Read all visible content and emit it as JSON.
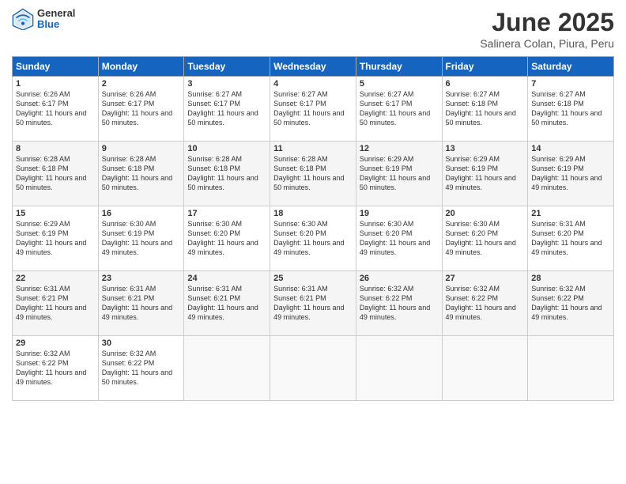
{
  "header": {
    "logo_general": "General",
    "logo_blue": "Blue",
    "title": "June 2025",
    "subtitle": "Salinera Colan, Piura, Peru"
  },
  "calendar": {
    "days_of_week": [
      "Sunday",
      "Monday",
      "Tuesday",
      "Wednesday",
      "Thursday",
      "Friday",
      "Saturday"
    ],
    "weeks": [
      [
        {
          "day": "1",
          "sunrise": "Sunrise: 6:26 AM",
          "sunset": "Sunset: 6:17 PM",
          "daylight": "Daylight: 11 hours and 50 minutes."
        },
        {
          "day": "2",
          "sunrise": "Sunrise: 6:26 AM",
          "sunset": "Sunset: 6:17 PM",
          "daylight": "Daylight: 11 hours and 50 minutes."
        },
        {
          "day": "3",
          "sunrise": "Sunrise: 6:27 AM",
          "sunset": "Sunset: 6:17 PM",
          "daylight": "Daylight: 11 hours and 50 minutes."
        },
        {
          "day": "4",
          "sunrise": "Sunrise: 6:27 AM",
          "sunset": "Sunset: 6:17 PM",
          "daylight": "Daylight: 11 hours and 50 minutes."
        },
        {
          "day": "5",
          "sunrise": "Sunrise: 6:27 AM",
          "sunset": "Sunset: 6:17 PM",
          "daylight": "Daylight: 11 hours and 50 minutes."
        },
        {
          "day": "6",
          "sunrise": "Sunrise: 6:27 AM",
          "sunset": "Sunset: 6:18 PM",
          "daylight": "Daylight: 11 hours and 50 minutes."
        },
        {
          "day": "7",
          "sunrise": "Sunrise: 6:27 AM",
          "sunset": "Sunset: 6:18 PM",
          "daylight": "Daylight: 11 hours and 50 minutes."
        }
      ],
      [
        {
          "day": "8",
          "sunrise": "Sunrise: 6:28 AM",
          "sunset": "Sunset: 6:18 PM",
          "daylight": "Daylight: 11 hours and 50 minutes."
        },
        {
          "day": "9",
          "sunrise": "Sunrise: 6:28 AM",
          "sunset": "Sunset: 6:18 PM",
          "daylight": "Daylight: 11 hours and 50 minutes."
        },
        {
          "day": "10",
          "sunrise": "Sunrise: 6:28 AM",
          "sunset": "Sunset: 6:18 PM",
          "daylight": "Daylight: 11 hours and 50 minutes."
        },
        {
          "day": "11",
          "sunrise": "Sunrise: 6:28 AM",
          "sunset": "Sunset: 6:18 PM",
          "daylight": "Daylight: 11 hours and 50 minutes."
        },
        {
          "day": "12",
          "sunrise": "Sunrise: 6:29 AM",
          "sunset": "Sunset: 6:19 PM",
          "daylight": "Daylight: 11 hours and 50 minutes."
        },
        {
          "day": "13",
          "sunrise": "Sunrise: 6:29 AM",
          "sunset": "Sunset: 6:19 PM",
          "daylight": "Daylight: 11 hours and 49 minutes."
        },
        {
          "day": "14",
          "sunrise": "Sunrise: 6:29 AM",
          "sunset": "Sunset: 6:19 PM",
          "daylight": "Daylight: 11 hours and 49 minutes."
        }
      ],
      [
        {
          "day": "15",
          "sunrise": "Sunrise: 6:29 AM",
          "sunset": "Sunset: 6:19 PM",
          "daylight": "Daylight: 11 hours and 49 minutes."
        },
        {
          "day": "16",
          "sunrise": "Sunrise: 6:30 AM",
          "sunset": "Sunset: 6:19 PM",
          "daylight": "Daylight: 11 hours and 49 minutes."
        },
        {
          "day": "17",
          "sunrise": "Sunrise: 6:30 AM",
          "sunset": "Sunset: 6:20 PM",
          "daylight": "Daylight: 11 hours and 49 minutes."
        },
        {
          "day": "18",
          "sunrise": "Sunrise: 6:30 AM",
          "sunset": "Sunset: 6:20 PM",
          "daylight": "Daylight: 11 hours and 49 minutes."
        },
        {
          "day": "19",
          "sunrise": "Sunrise: 6:30 AM",
          "sunset": "Sunset: 6:20 PM",
          "daylight": "Daylight: 11 hours and 49 minutes."
        },
        {
          "day": "20",
          "sunrise": "Sunrise: 6:30 AM",
          "sunset": "Sunset: 6:20 PM",
          "daylight": "Daylight: 11 hours and 49 minutes."
        },
        {
          "day": "21",
          "sunrise": "Sunrise: 6:31 AM",
          "sunset": "Sunset: 6:20 PM",
          "daylight": "Daylight: 11 hours and 49 minutes."
        }
      ],
      [
        {
          "day": "22",
          "sunrise": "Sunrise: 6:31 AM",
          "sunset": "Sunset: 6:21 PM",
          "daylight": "Daylight: 11 hours and 49 minutes."
        },
        {
          "day": "23",
          "sunrise": "Sunrise: 6:31 AM",
          "sunset": "Sunset: 6:21 PM",
          "daylight": "Daylight: 11 hours and 49 minutes."
        },
        {
          "day": "24",
          "sunrise": "Sunrise: 6:31 AM",
          "sunset": "Sunset: 6:21 PM",
          "daylight": "Daylight: 11 hours and 49 minutes."
        },
        {
          "day": "25",
          "sunrise": "Sunrise: 6:31 AM",
          "sunset": "Sunset: 6:21 PM",
          "daylight": "Daylight: 11 hours and 49 minutes."
        },
        {
          "day": "26",
          "sunrise": "Sunrise: 6:32 AM",
          "sunset": "Sunset: 6:22 PM",
          "daylight": "Daylight: 11 hours and 49 minutes."
        },
        {
          "day": "27",
          "sunrise": "Sunrise: 6:32 AM",
          "sunset": "Sunset: 6:22 PM",
          "daylight": "Daylight: 11 hours and 49 minutes."
        },
        {
          "day": "28",
          "sunrise": "Sunrise: 6:32 AM",
          "sunset": "Sunset: 6:22 PM",
          "daylight": "Daylight: 11 hours and 49 minutes."
        }
      ],
      [
        {
          "day": "29",
          "sunrise": "Sunrise: 6:32 AM",
          "sunset": "Sunset: 6:22 PM",
          "daylight": "Daylight: 11 hours and 49 minutes."
        },
        {
          "day": "30",
          "sunrise": "Sunrise: 6:32 AM",
          "sunset": "Sunset: 6:22 PM",
          "daylight": "Daylight: 11 hours and 50 minutes."
        },
        {
          "day": "",
          "sunrise": "",
          "sunset": "",
          "daylight": ""
        },
        {
          "day": "",
          "sunrise": "",
          "sunset": "",
          "daylight": ""
        },
        {
          "day": "",
          "sunrise": "",
          "sunset": "",
          "daylight": ""
        },
        {
          "day": "",
          "sunrise": "",
          "sunset": "",
          "daylight": ""
        },
        {
          "day": "",
          "sunrise": "",
          "sunset": "",
          "daylight": ""
        }
      ]
    ]
  }
}
